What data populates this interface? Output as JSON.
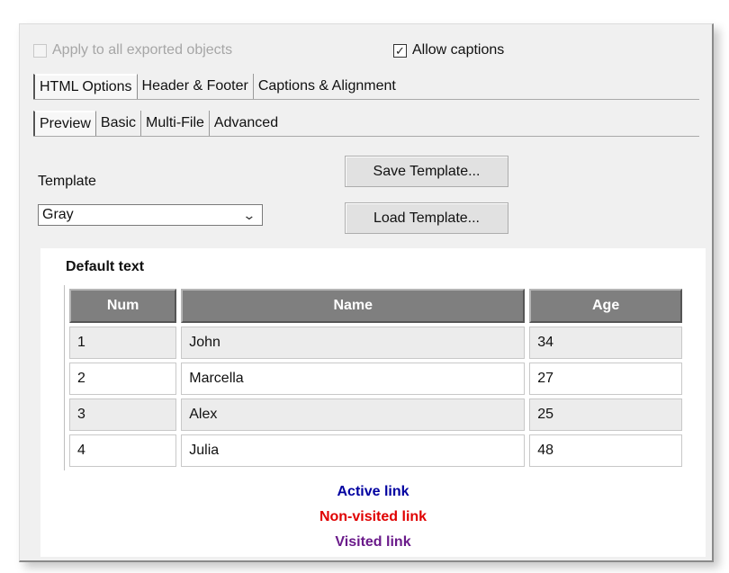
{
  "options": {
    "apply_all_label": "Apply to all exported objects",
    "apply_all_checked": false,
    "allow_captions_label": "Allow captions",
    "allow_captions_checked": true
  },
  "main_tabs": [
    {
      "label": "HTML Options",
      "active": true
    },
    {
      "label": "Header & Footer",
      "active": false
    },
    {
      "label": "Captions & Alignment",
      "active": false
    }
  ],
  "sub_tabs": [
    {
      "label": "Preview",
      "active": true
    },
    {
      "label": "Basic",
      "active": false
    },
    {
      "label": "Multi-File",
      "active": false
    },
    {
      "label": "Advanced",
      "active": false
    }
  ],
  "template": {
    "label": "Template",
    "value": "Gray",
    "save_button": "Save Template...",
    "load_button": "Load Template..."
  },
  "preview": {
    "default_text": "Default text",
    "columns": [
      "Num",
      "Name",
      "Age"
    ],
    "rows": [
      [
        "1",
        "John",
        "34"
      ],
      [
        "2",
        "Marcella",
        "27"
      ],
      [
        "3",
        "Alex",
        "25"
      ],
      [
        "4",
        "Julia",
        "48"
      ]
    ],
    "links": {
      "active": "Active link",
      "non_visited": "Non-visited link",
      "visited": "Visited link"
    }
  },
  "colors": {
    "header_bg": "#7f7f7f",
    "row_alt_bg": "#ececec",
    "active_link": "#0000a0",
    "non_visited_link": "#e00000",
    "visited_link": "#6a1a8a"
  }
}
